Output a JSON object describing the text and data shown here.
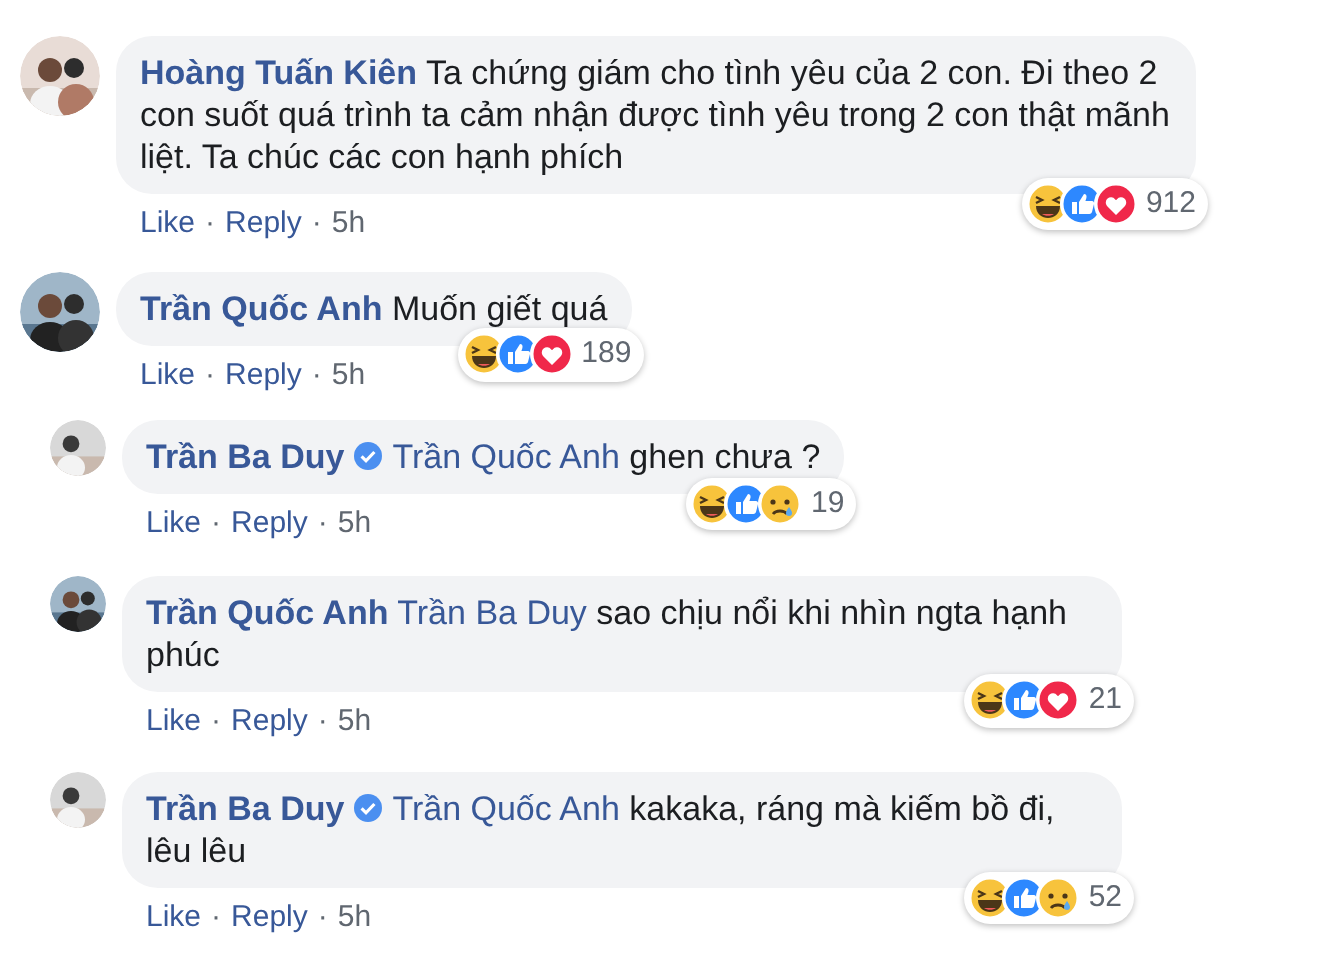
{
  "comments": [
    {
      "author": "Hoàng Tuấn Kiên",
      "verified": false,
      "text": "Ta chứng giám cho tình yêu của 2 con. Đi theo 2 con suốt quá trình ta cảm nhận được tình yêu trong 2 con thật mãnh liệt. Ta chúc các con hạnh phích",
      "like": "Like",
      "separator": "·",
      "reply": "Reply",
      "time": "5h",
      "reactions": [
        {
          "kind": "haha"
        },
        {
          "kind": "like"
        },
        {
          "kind": "love"
        }
      ],
      "count": "912"
    },
    {
      "author": "Trần Quốc Anh",
      "verified": false,
      "text": "Muốn giết quá",
      "like": "Like",
      "separator": "·",
      "reply": "Reply",
      "time": "5h",
      "reactions": [
        {
          "kind": "haha"
        },
        {
          "kind": "like"
        },
        {
          "kind": "love"
        }
      ],
      "count": "189",
      "children": [
        {
          "author": "Trần Ba Duy",
          "verified": true,
          "mention": "Trần Quốc Anh",
          "text": "ghen chưa ?",
          "like": "Like",
          "separator": "·",
          "reply": "Reply",
          "time": "5h",
          "reactions": [
            {
              "kind": "haha"
            },
            {
              "kind": "like"
            },
            {
              "kind": "sad"
            }
          ],
          "count": "19"
        },
        {
          "author": "Trần Quốc Anh",
          "verified": false,
          "mention": "Trần Ba Duy",
          "text": "sao chịu nổi khi nhìn ngta hạnh phúc",
          "like": "Like",
          "separator": "·",
          "reply": "Reply",
          "time": "5h",
          "reactions": [
            {
              "kind": "haha"
            },
            {
              "kind": "like"
            },
            {
              "kind": "love"
            }
          ],
          "count": "21"
        },
        {
          "author": "Trần Ba Duy",
          "verified": true,
          "mention": "Trần Quốc Anh",
          "text": "kakaka, ráng mà kiếm bồ đi, lêu lêu",
          "like": "Like",
          "separator": "·",
          "reply": "Reply",
          "time": "5h",
          "reactions": [
            {
              "kind": "haha"
            },
            {
              "kind": "like"
            },
            {
              "kind": "sad"
            }
          ],
          "count": "52"
        }
      ]
    }
  ]
}
